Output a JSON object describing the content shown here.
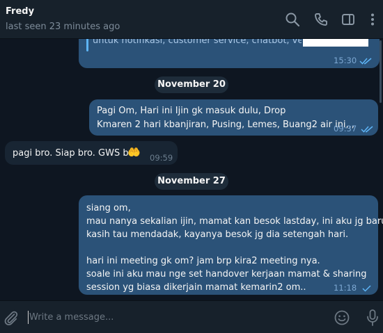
{
  "header": {
    "contact_name": "Fredy",
    "last_seen": "last seen 23 minutes ago",
    "icons": [
      "search-icon",
      "phone-icon",
      "sidebar-toggle-icon",
      "more-vertical-icon"
    ]
  },
  "messages": [
    {
      "direction": "outgoing",
      "text_lines": [
        "untuk notifikasi, customer service, chatbot, ven..."
      ],
      "time": "15:30",
      "status": "read"
    },
    {
      "type": "date",
      "label": "November 20"
    },
    {
      "direction": "outgoing",
      "text_lines": [
        "Pagi Om, Hari ini Ijin gk masuk dulu, Drop",
        "Kmaren 2 hari kbanjiran, Pusing, Lemes, Buang2 air ini,,,"
      ],
      "time": "09:37",
      "status": "read"
    },
    {
      "direction": "incoming",
      "text_lines": [
        "pagi bro. Siap bro. GWS bro"
      ],
      "emoji": "🤲",
      "time": "09:59"
    },
    {
      "type": "date",
      "label": "November 27"
    },
    {
      "direction": "outgoing",
      "text_lines": [
        "siang om,",
        "mau nanya sekalian ijin, mamat kan besok lastday, ini aku jg baru di",
        "kasih tau mendadak, kayanya besok jg dia setengah hari.",
        "",
        "hari ini meeting gk om? jam brp kira2 meeting nya.",
        "soale ini aku mau nge set handover kerjaan mamat & sharing",
        "session yg biasa dikerjain mamat kemarin2 om.."
      ],
      "time": "11:18",
      "status": "sent"
    }
  ],
  "composer": {
    "placeholder": "Write a message...",
    "value": ""
  },
  "colors": {
    "background": "#0e1621",
    "header": "#17212b",
    "outgoing_bubble": "#2b5278",
    "incoming_bubble": "#182533",
    "accent": "#5eb5f7"
  }
}
